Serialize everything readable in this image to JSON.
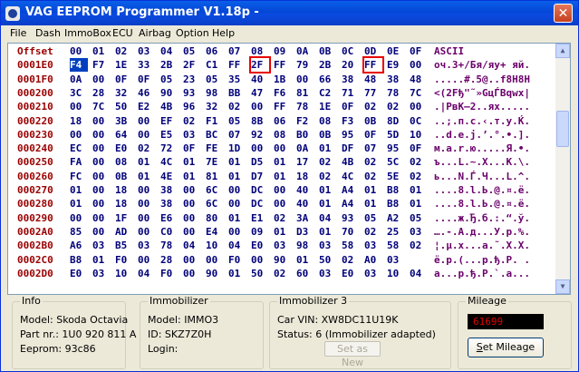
{
  "window": {
    "title": "VAG EEPROM Programmer   V1.18p -",
    "close_glyph": "✕"
  },
  "menu": [
    "File",
    "Dash",
    "ImmoBox",
    "ECU",
    "Airbag",
    "Option",
    "Help"
  ],
  "hex": {
    "header_offset": "Offset",
    "header_cols": [
      "00",
      "01",
      "02",
      "03",
      "04",
      "05",
      "06",
      "07",
      "08",
      "09",
      "0A",
      "0B",
      "0C",
      "0D",
      "0E",
      "0F"
    ],
    "header_ascii": "ASCII",
    "selected": {
      "row": 0,
      "col": 0
    },
    "marked": [
      {
        "row": 0,
        "col": 8
      },
      {
        "row": 0,
        "col": 13
      }
    ],
    "rows": [
      {
        "offset": "0001E0",
        "bytes": [
          "F4",
          "F7",
          "1E",
          "33",
          "2B",
          "2F",
          "C1",
          "FF",
          "2F",
          "FF",
          "79",
          "2B",
          "20",
          "FF",
          "E9",
          "00"
        ],
        "ascii": "оч.3+/Бя/яу+ яй."
      },
      {
        "offset": "0001F0",
        "bytes": [
          "0A",
          "00",
          "0F",
          "0F",
          "05",
          "23",
          "05",
          "35",
          "40",
          "1B",
          "00",
          "66",
          "38",
          "48",
          "38",
          "48"
        ],
        "ascii": ".....#.5@..f8H8H"
      },
      {
        "offset": "000200",
        "bytes": [
          "3C",
          "28",
          "32",
          "46",
          "90",
          "93",
          "98",
          "BB",
          "47",
          "F6",
          "81",
          "C2",
          "71",
          "77",
          "78",
          "7C"
        ],
        "ascii": "<(2Fђ\"˜»GцЃВqwx|"
      },
      {
        "offset": "000210",
        "bytes": [
          "00",
          "7C",
          "50",
          "E2",
          "4B",
          "96",
          "32",
          "02",
          "00",
          "FF",
          "78",
          "1E",
          "0F",
          "02",
          "02",
          "00"
        ],
        "ascii": ".|PвK–2..яx....."
      },
      {
        "offset": "000220",
        "bytes": [
          "18",
          "00",
          "3B",
          "00",
          "EF",
          "02",
          "F1",
          "05",
          "8B",
          "06",
          "F2",
          "08",
          "F3",
          "0B",
          "8D",
          "0C"
        ],
        "ascii": "..;.п.с.‹.т.у.Ќ."
      },
      {
        "offset": "000230",
        "bytes": [
          "00",
          "00",
          "64",
          "00",
          "E5",
          "03",
          "BC",
          "07",
          "92",
          "08",
          "B0",
          "0B",
          "95",
          "0F",
          "5D",
          "10"
        ],
        "ascii": "..d.е.ј.’.°.•.]."
      },
      {
        "offset": "000240",
        "bytes": [
          "EC",
          "00",
          "E0",
          "02",
          "72",
          "0F",
          "FE",
          "1D",
          "00",
          "00",
          "0A",
          "01",
          "DF",
          "07",
          "95",
          "0F"
        ],
        "ascii": "м.а.r.ю.....Я.•."
      },
      {
        "offset": "000250",
        "bytes": [
          "FA",
          "00",
          "08",
          "01",
          "4C",
          "01",
          "7E",
          "01",
          "D5",
          "01",
          "17",
          "02",
          "4B",
          "02",
          "5C",
          "02"
        ],
        "ascii": "ъ...L.~.Х...K.\\."
      },
      {
        "offset": "000260",
        "bytes": [
          "FC",
          "00",
          "0B",
          "01",
          "4E",
          "01",
          "81",
          "01",
          "D7",
          "01",
          "18",
          "02",
          "4C",
          "02",
          "5E",
          "02"
        ],
        "ascii": "ь...N.Ѓ.Ч...L.^."
      },
      {
        "offset": "000270",
        "bytes": [
          "01",
          "00",
          "18",
          "00",
          "38",
          "00",
          "6C",
          "00",
          "DC",
          "00",
          "40",
          "01",
          "A4",
          "01",
          "B8",
          "01"
        ],
        "ascii": "....8.l.Ь.@.¤.ё."
      },
      {
        "offset": "000280",
        "bytes": [
          "01",
          "00",
          "18",
          "00",
          "38",
          "00",
          "6C",
          "00",
          "DC",
          "00",
          "40",
          "01",
          "A4",
          "01",
          "B8",
          "01"
        ],
        "ascii": "....8.l.Ь.@.¤.ё."
      },
      {
        "offset": "000290",
        "bytes": [
          "00",
          "00",
          "1F",
          "00",
          "E6",
          "00",
          "80",
          "01",
          "E1",
          "02",
          "3A",
          "04",
          "93",
          "05",
          "A2",
          "05"
        ],
        "ascii": "....ж.Ђ.б.:.“.ў."
      },
      {
        "offset": "0002A0",
        "bytes": [
          "85",
          "00",
          "AD",
          "00",
          "C0",
          "00",
          "E4",
          "00",
          "09",
          "01",
          "D3",
          "01",
          "70",
          "02",
          "25",
          "03"
        ],
        "ascii": "….-.А.д...У.p.%."
      },
      {
        "offset": "0002B0",
        "bytes": [
          "A6",
          "03",
          "B5",
          "03",
          "78",
          "04",
          "10",
          "04",
          "E0",
          "03",
          "98",
          "03",
          "58",
          "03",
          "58",
          "02"
        ],
        "ascii": "¦.µ.x...а.˜.X.X."
      },
      {
        "offset": "0002C0",
        "bytes": [
          "B8",
          "01",
          "F0",
          "00",
          "28",
          "00",
          "00",
          "F0",
          "00",
          "90",
          "01",
          "50",
          "02",
          "A0",
          "03"
        ],
        "ascii": "ё.р.(...р.ђ.P. ."
      },
      {
        "offset": "0002D0",
        "bytes": [
          "E0",
          "03",
          "10",
          "04",
          "F0",
          "00",
          "90",
          "01",
          "50",
          "02",
          "60",
          "03",
          "E0",
          "03",
          "10",
          "04"
        ],
        "ascii": "а...р.ђ.P.`.а..."
      }
    ]
  },
  "info": {
    "legend": "Info",
    "model": "Model:  Skoda Octavia",
    "part": "Part nr.: 1U0 920 811 A",
    "eeprom": "Eeprom: 93c86"
  },
  "immobilizer": {
    "legend": "Immobilizer",
    "model": "Model:   IMMO3",
    "id": "ID: SKZ7Z0H",
    "login": "Login:"
  },
  "immobilizer3": {
    "legend": "Immobilizer 3",
    "vin": "Car VIN: XW8DC11U19K",
    "status": "Status: 6 (Immobilizer adapted)",
    "set_as_new": "Set as New"
  },
  "mileage": {
    "legend": "Mileage",
    "value": "61699",
    "button_prefix": "",
    "button_underline": "S",
    "button_rest": "et Mileage"
  }
}
